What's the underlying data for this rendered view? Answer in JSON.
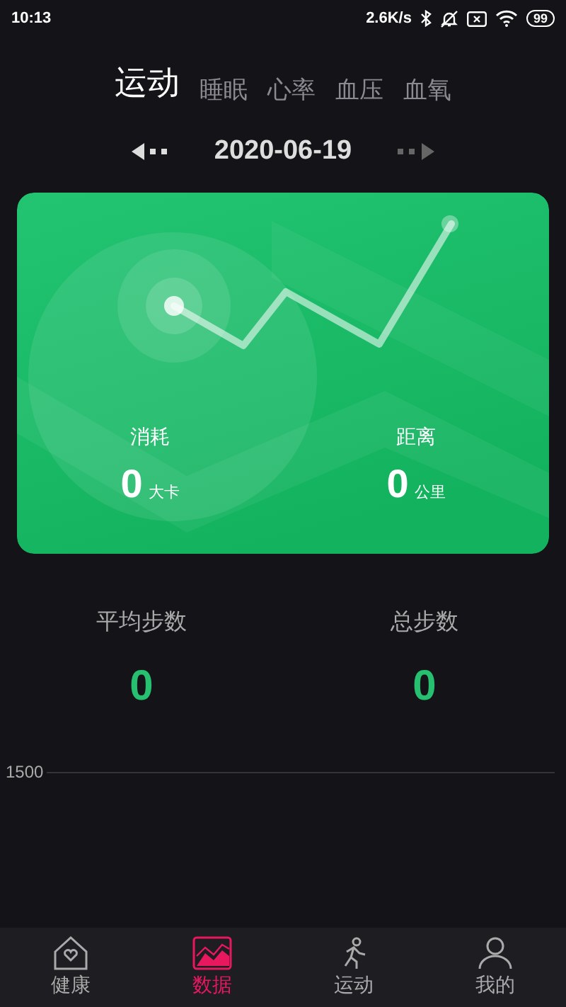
{
  "status_bar": {
    "time": "10:13",
    "speed": "2.6K/s",
    "battery": "99"
  },
  "tabs": [
    {
      "label": "运动",
      "selected": true
    },
    {
      "label": "睡眠",
      "selected": false
    },
    {
      "label": "心率",
      "selected": false
    },
    {
      "label": "血压",
      "selected": false
    },
    {
      "label": "血氧",
      "selected": false
    }
  ],
  "date": "2020-06-19",
  "card": {
    "stats": [
      {
        "label": "消耗",
        "value": "0",
        "unit": "大卡"
      },
      {
        "label": "距离",
        "value": "0",
        "unit": "公里"
      }
    ]
  },
  "summary": [
    {
      "label": "平均步数",
      "value": "0"
    },
    {
      "label": "总步数",
      "value": "0"
    }
  ],
  "chart_gridline_label": "1500",
  "nav": [
    {
      "label": "健康",
      "kind": "home",
      "selected": false
    },
    {
      "label": "数据",
      "kind": "data",
      "selected": true
    },
    {
      "label": "运动",
      "kind": "sport",
      "selected": false
    },
    {
      "label": "我的",
      "kind": "user",
      "selected": false
    }
  ]
}
